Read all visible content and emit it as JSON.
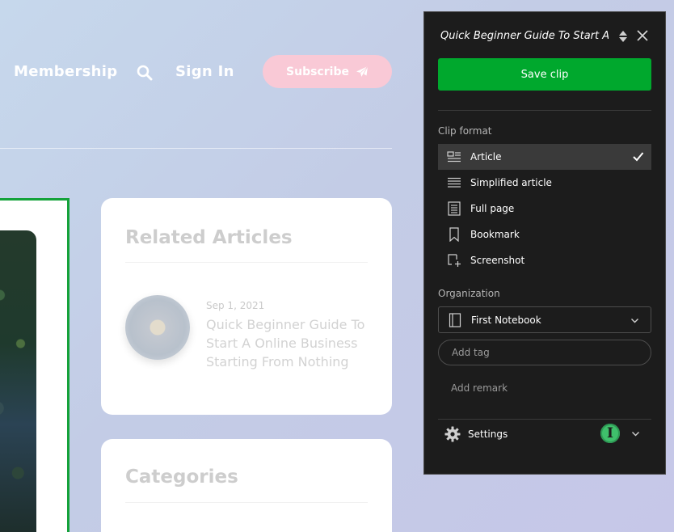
{
  "site": {
    "nav": {
      "membership": "Membership",
      "signin": "Sign In",
      "subscribe": "Subscribe",
      "search_icon": "search-icon",
      "subscribe_icon": "paper-plane-icon"
    },
    "related": {
      "title": "Related Articles",
      "article": {
        "date": "Sep 1, 2021",
        "title": "Quick Beginner Guide To Start A Online Business Starting From Nothing"
      }
    },
    "categories": {
      "title": "Categories"
    },
    "colors": {
      "accent_green": "#14a23a",
      "subscribe_pink": "#f9c9d6"
    }
  },
  "clipper": {
    "title": "Quick Beginner Guide To Start A Online Business Starting From Nothing",
    "save_label": "Save clip",
    "format_label": "Clip format",
    "formats": [
      {
        "label": "Article",
        "icon": "article-icon",
        "selected": true
      },
      {
        "label": "Simplified article",
        "icon": "simplified-article-icon",
        "selected": false
      },
      {
        "label": "Full page",
        "icon": "full-page-icon",
        "selected": false
      },
      {
        "label": "Bookmark",
        "icon": "bookmark-icon",
        "selected": false
      },
      {
        "label": "Screenshot",
        "icon": "screenshot-icon",
        "selected": false
      }
    ],
    "organization_label": "Organization",
    "notebook": "First Notebook",
    "tag_placeholder": "Add tag",
    "remark_placeholder": "Add remark",
    "settings_label": "Settings",
    "avatar_initial": "I",
    "colors": {
      "save_green": "#00a82d",
      "panel_bg": "#1c1c1c",
      "avatar_green": "#3fbf6b"
    }
  }
}
